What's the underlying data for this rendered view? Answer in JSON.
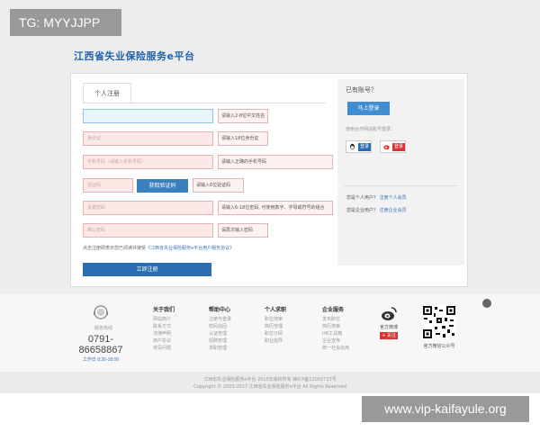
{
  "watermarks": {
    "top_left": "TG: MYYJJPP",
    "bottom_right": "www.vip-kaifayule.org"
  },
  "header": {
    "logo_text": "江西省失业保险服务e平台"
  },
  "form": {
    "tab_label": "个人注册",
    "fields": [
      {
        "placeholder": "",
        "hint": "请输入2-8位中文姓名"
      },
      {
        "placeholder": "身份证",
        "hint": "请输入18位身份证"
      },
      {
        "placeholder": "手机号码（请输入手机号码）",
        "hint": "请输入正确的手机号码"
      },
      {
        "placeholder": "验证码",
        "hint": "请输入6位验证码"
      },
      {
        "placeholder": "设置密码",
        "hint": "请输入6-18位密码, 可使用数字、字母或符号的组合"
      },
      {
        "placeholder": "确认密码",
        "hint": "请再次输入密码"
      }
    ],
    "get_code_label": "获取验证码",
    "agree_text": "点击注册即表示您已阅读并接受",
    "agree_link": "《江西省失业保险服务e平台用户服务协议》",
    "register_label": "立即注册"
  },
  "side": {
    "has_account": "已有账号？",
    "login_label": "马上登录",
    "coop_text": "使用合作网站账号登录：",
    "qq_label": "登录",
    "weibo_label": "登录",
    "personal_q": "您是个人用户？",
    "personal_link": "注册个人会员",
    "company_q": "您是企业用户？",
    "company_link": "注册企业会员"
  },
  "footer": {
    "hotline_label": "服务热线",
    "hotline_number": "0791-86658867",
    "work_hours": "工作日 8:30-18:00",
    "columns": [
      {
        "title": "关于我们",
        "items": [
          "网站简介",
          "联系方式",
          "法律声明",
          "用户协议",
          "常见问题"
        ]
      },
      {
        "title": "帮助中心",
        "items": [
          "注册与登录",
          "密码找回",
          "认证管理",
          "招聘管理",
          "求职管理"
        ]
      },
      {
        "title": "个人求职",
        "items": [
          "职位搜索",
          "简历管理",
          "职位订阅",
          "职业指导"
        ]
      },
      {
        "title": "企业服务",
        "items": [
          "发布职位",
          "简历搜索",
          "HR工具箱",
          "企业宣传",
          "统一社会信用"
        ]
      }
    ],
    "weibo_title": "官方微博",
    "weibo_follow": "+ 关注",
    "wechat_title": "官方微信公众号",
    "icp": "江西省失业保险服务e平台  2015年版权所有  赣ICP备12002733号",
    "copyright": "Copyright © 2003-2017 江西省失业保险服务e平台 All Rights Reserved"
  },
  "colors": {
    "primary": "#2c6db0",
    "error_bg": "#fde8e8",
    "side_bg": "#f2f2f2"
  }
}
